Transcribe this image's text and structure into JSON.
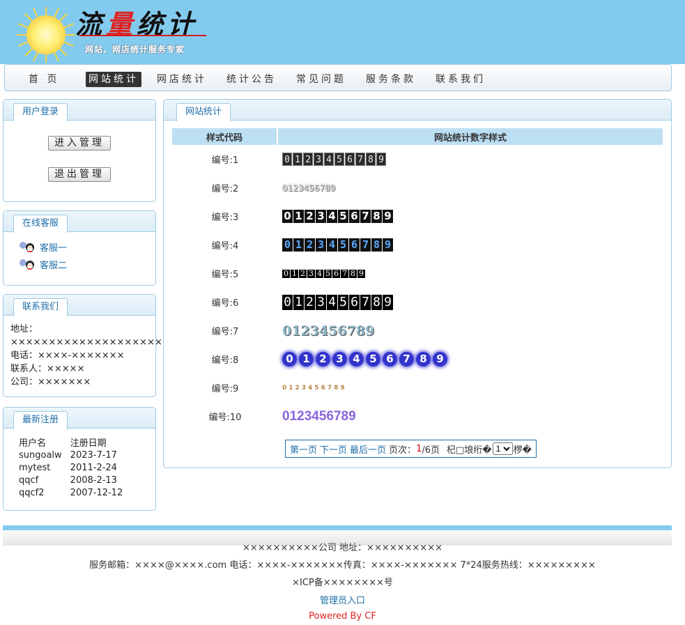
{
  "header": {
    "logo_title_1": "流",
    "logo_title_2": "量",
    "logo_title_3": "统计",
    "logo_subtitle": "网站、网店统计服务专家"
  },
  "nav": {
    "items": [
      {
        "label": "首 页"
      },
      {
        "label": "网站统计"
      },
      {
        "label": "网店统计"
      },
      {
        "label": "统计公告"
      },
      {
        "label": "常见问题"
      },
      {
        "label": "服务条款"
      },
      {
        "label": "联系我们"
      }
    ],
    "active_index": 1
  },
  "login": {
    "title": "用户登录",
    "enter_label": "进入管理",
    "exit_label": "退出管理"
  },
  "service": {
    "title": "在线客服",
    "items": [
      "客服一",
      "客服二"
    ]
  },
  "contact": {
    "title": "联系我们",
    "address_label": "地址：",
    "address_value": "××××××××××××××××××××",
    "phone": "电话：××××-×××××××",
    "person": "联系人：×××××",
    "company": "公司：×××××××"
  },
  "latest": {
    "title": "最新注册",
    "col_user": "用户名",
    "col_date": "注册日期",
    "rows": [
      {
        "user": "sungoalw",
        "date": "2023-7-17"
      },
      {
        "user": "mytest",
        "date": "2011-2-24"
      },
      {
        "user": "qqcf",
        "date": "2008-2-13"
      },
      {
        "user": "qqcf2",
        "date": "2007-12-12"
      }
    ]
  },
  "main": {
    "tab_title": "网站统计",
    "col_code": "样式代码",
    "col_style": "网站统计数字样式",
    "rows": [
      {
        "code": "编号:1",
        "digits": "0123456789"
      },
      {
        "code": "编号:2",
        "digits": "0123456789"
      },
      {
        "code": "编号:3",
        "digits": "0123456789"
      },
      {
        "code": "编号:4",
        "digits": "0123456789"
      },
      {
        "code": "编号:5",
        "digits": "0123456789"
      },
      {
        "code": "编号:6",
        "digits": "0123456789"
      },
      {
        "code": "编号:7",
        "digits": "0123456789"
      },
      {
        "code": "编号:8",
        "digits": "0123456789"
      },
      {
        "code": "编号:9",
        "digits": "0123456789"
      },
      {
        "code": "编号:10",
        "digits": "0123456789"
      }
    ],
    "pager": {
      "first": "第一页",
      "next": "下一页",
      "last": "最后一页",
      "page_label": "页次：",
      "current": "1",
      "total": "/6页",
      "goto_prefix": "杞□埌绗�",
      "selected": "1",
      "goto_suffix": "椤�"
    }
  },
  "footer": {
    "line1": "××××××××××公司 地址：××××××××××",
    "line2": "服务邮箱：××××@××××.com 电话：××××-×××××××传真：××××-××××××× 7*24服务热线：×××××××××",
    "line3": "×ICP备××××××××号",
    "admin_link": "管理员入口",
    "powered": "Powered By CF"
  }
}
